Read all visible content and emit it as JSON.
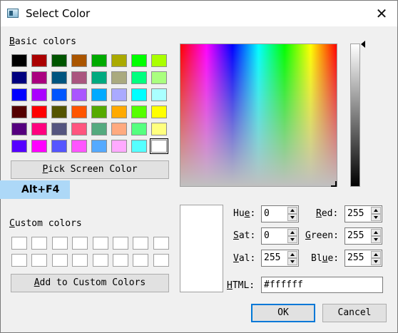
{
  "window": {
    "title": "Select Color",
    "close_glyph": "✕"
  },
  "basic_colors": {
    "label_prefix": "B",
    "label_rest": "asic colors",
    "swatches": [
      "#000000",
      "#aa0000",
      "#005500",
      "#aa5500",
      "#00aa00",
      "#aaaa00",
      "#00ff00",
      "#aaff00",
      "#00007f",
      "#aa007f",
      "#00557f",
      "#aa557f",
      "#00aa7f",
      "#aaaa7f",
      "#00ff7f",
      "#aaff7f",
      "#0000ff",
      "#aa00ff",
      "#0055ff",
      "#aa55ff",
      "#00aaff",
      "#aaaaff",
      "#00ffff",
      "#aaffff",
      "#550000",
      "#ff0000",
      "#555500",
      "#ff5500",
      "#55aa00",
      "#ffaa00",
      "#55ff00",
      "#ffff00",
      "#55007f",
      "#ff007f",
      "#55557f",
      "#ff557f",
      "#55aa7f",
      "#ffaa7f",
      "#55ff7f",
      "#ffff7f",
      "#5500ff",
      "#ff00ff",
      "#5555ff",
      "#ff55ff",
      "#55aaff",
      "#ffaaff",
      "#55ffff",
      "#ffffff"
    ],
    "selected_color": "#ffffff"
  },
  "pick_screen": {
    "prefix": "P",
    "rest": "ick Screen Color"
  },
  "tooltip": {
    "text": "Alt+F4"
  },
  "custom_colors": {
    "label_prefix": "C",
    "label_rest": "ustom colors",
    "count": 16
  },
  "add_custom": {
    "prefix": "A",
    "rest": "dd to Custom Colors"
  },
  "fields": {
    "hue": {
      "prefix": "Hu",
      "mn": "e",
      "suffix": ":",
      "value": "0"
    },
    "sat": {
      "prefix": "",
      "mn": "S",
      "suffix": "at:",
      "value": "0"
    },
    "val": {
      "prefix": "",
      "mn": "V",
      "suffix": "al:",
      "value": "255"
    },
    "red": {
      "prefix": "",
      "mn": "R",
      "suffix": "ed:",
      "value": "255"
    },
    "green": {
      "prefix": "",
      "mn": "G",
      "suffix": "reen:",
      "value": "255"
    },
    "blue": {
      "prefix": "Bl",
      "mn": "u",
      "suffix": "e:",
      "value": "255"
    },
    "html": {
      "prefix": "",
      "mn": "H",
      "suffix": "TML:",
      "value": "#ffffff"
    }
  },
  "preview_color": "#ffffff",
  "buttons": {
    "ok": "OK",
    "cancel": "Cancel"
  }
}
